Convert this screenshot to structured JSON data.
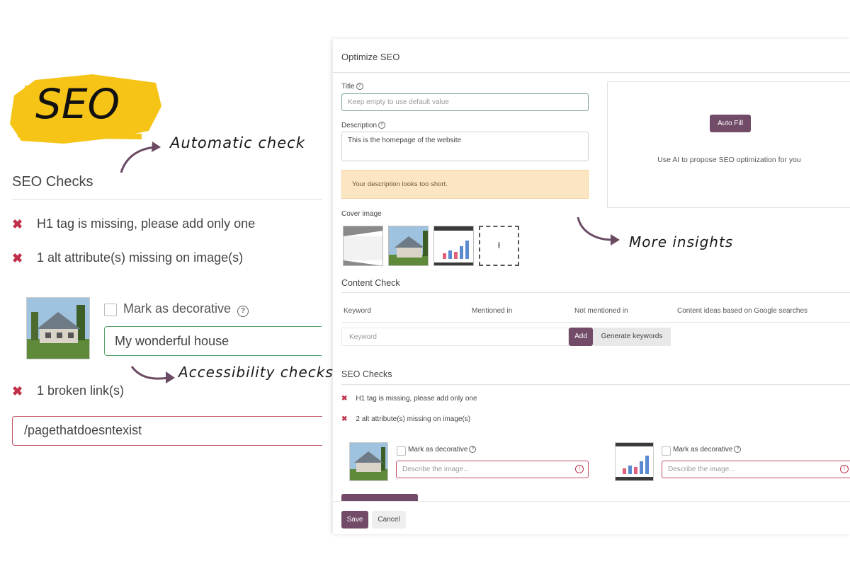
{
  "left": {
    "logo_text": "SEO",
    "automatic_label": "Automatic check",
    "section_title": "SEO Checks",
    "checks": [
      {
        "text": "H1 tag is missing, please add only one"
      },
      {
        "text": "1 alt attribute(s) missing on image(s)"
      }
    ],
    "mark_decorative_label": "Mark as decorative",
    "alt_input_value": "My wonderful house",
    "accessibility_label": "Accessibility checks",
    "broken_link_text": "1 broken link(s)",
    "broken_link_value": "/pagethatdoesntexist"
  },
  "dialog": {
    "title": "Optimize SEO",
    "title_label": "Title",
    "title_placeholder": "Keep empty to use default value",
    "description_label": "Description",
    "description_value": "This is the homepage of the website",
    "warning_text": "Your description looks too short.",
    "autofill_label": "Auto Fill",
    "ai_text": "Use AI to propose SEO optimization for you",
    "cover_image_label": "Cover image",
    "upload_icon": "⭱",
    "more_insights_label": "More insights",
    "content_check_title": "Content Check",
    "table_headers": [
      "Keyword",
      "Mentioned in",
      "Not mentioned in",
      "Content ideas based on Google searches"
    ],
    "keyword_placeholder": "Keyword",
    "add_label": "Add",
    "generate_label": "Generate keywords",
    "seo_checks_title": "SEO Checks",
    "checks": [
      {
        "text": "H1 tag is missing, please add only one"
      },
      {
        "text": "2 alt attribute(s) missing on image(s)"
      }
    ],
    "mark_decorative_label": "Mark as decorative",
    "describe_placeholder": "Describe the image...",
    "save_label": "Save",
    "cancel_label": "Cancel"
  },
  "colors": {
    "brand": "#714b67",
    "error": "#c0304a",
    "warning_bg": "#fbe5c3",
    "valid_border": "#5aa36a"
  }
}
